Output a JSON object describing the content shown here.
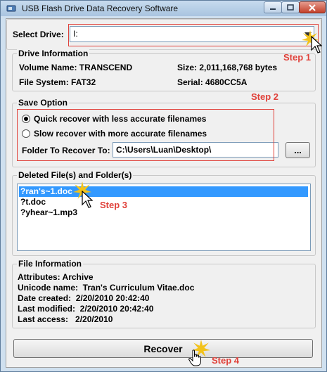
{
  "window": {
    "title": "USB Flash Drive Data Recovery Software"
  },
  "select_drive": {
    "label": "Select Drive:",
    "value": "I:"
  },
  "drive_info": {
    "legend": "Drive Information",
    "volume_name": "Volume Name: TRANSCEND",
    "size": "Size: 2,011,168,768 bytes",
    "file_system": "File System: FAT32",
    "serial": "Serial: 4680CC5A"
  },
  "save_option": {
    "legend": "Save Option",
    "quick": "Quick recover with less accurate filenames",
    "slow": "Slow recover with more accurate filenames",
    "folder_label": "Folder To Recover To:",
    "folder_value": "C:\\Users\\Luan\\Desktop\\",
    "browse_label": "...",
    "selected": "quick"
  },
  "deleted": {
    "legend": "Deleted File(s) and Folder(s)",
    "items": [
      "?ran's~1.doc",
      "?t.doc",
      "?yhear~1.mp3"
    ],
    "selected_index": 0
  },
  "file_info": {
    "legend": "File Information",
    "attributes": "Attributes:    Archive",
    "unicode_name": "Unicode name:  Tran's Curriculum Vitae.doc",
    "date_created": "Date created:  2/20/2010 20:42:40",
    "last_modified": "Last modified:  2/20/2010 20:42:40",
    "last_access": "Last access:   2/20/2010"
  },
  "recover_label": "Recover",
  "steps": [
    "Step 1",
    "Step 2",
    "Step 3",
    "Step 4"
  ],
  "colors": {
    "annotation": "#e0413a",
    "selection": "#3399ff",
    "starburst": "#f2c21b"
  },
  "icons": [
    "app-icon",
    "minimize-icon",
    "maximize-icon",
    "close-icon",
    "dropdown-arrow-icon",
    "pointer-cursor-icon",
    "hand-cursor-icon",
    "starburst-icon"
  ]
}
